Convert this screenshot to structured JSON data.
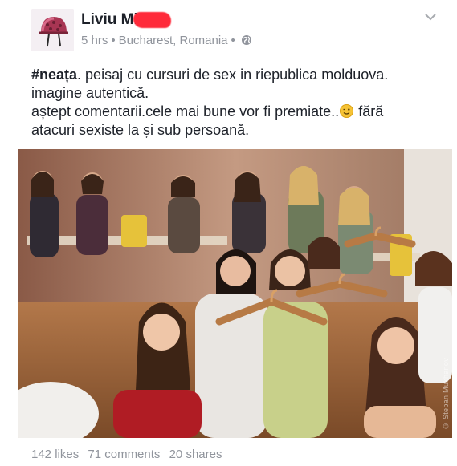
{
  "post": {
    "author": "Liviu Mi",
    "time": "5 hrs",
    "location": "Bucharest, Romania",
    "privacy_icon": "globe-icon",
    "menu_icon": "chevron-down-icon",
    "hashtag": "#neața",
    "line1_rest": ". peisaj cu cursuri de sex in riepublica molduova.",
    "line2": "imagine autentică.",
    "line3_before_emoji": "aștept comentarii.cele mai bune vor fi premiate..",
    "emoji_icon": "smiley-wink-icon",
    "line3_after_emoji": " fără",
    "line4": "atacuri sexiste la și sub persoană.",
    "photo_watermark": "© Stepan Mukhanov"
  },
  "stats": {
    "likes": "142 likes",
    "comments": "71 comments",
    "shares": "20 shares"
  },
  "colors": {
    "name_redaction": "#ff2a3a",
    "meta_text": "#90949c",
    "body_text": "#1d2129"
  }
}
